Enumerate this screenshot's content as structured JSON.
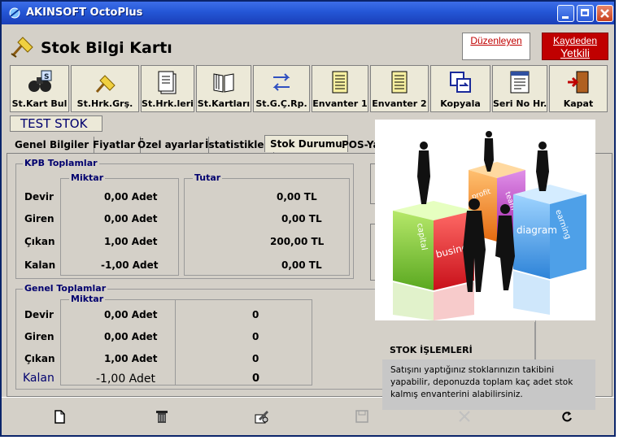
{
  "window": {
    "title": "AKINSOFT OctoPlus"
  },
  "header": {
    "title": "Stok Bilgi Kartı",
    "editor_label": "Düzenleyen",
    "saver_line1": "Kaydeden",
    "saver_line2": "Yetkili"
  },
  "toolbar": {
    "items": [
      {
        "label": "St.Kart Bul",
        "icon": "binoculars-icon"
      },
      {
        "label": "St.Hrk.Grş.",
        "icon": "broom-icon"
      },
      {
        "label": "St.Hrk.leri",
        "icon": "document-icon"
      },
      {
        "label": "St.Kartları",
        "icon": "book-icon"
      },
      {
        "label": "St.G.Ç.Rp.",
        "icon": "swap-arrows-icon"
      },
      {
        "label": "Envanter 1",
        "icon": "ledger-icon"
      },
      {
        "label": "Envanter 2",
        "icon": "ledger-icon"
      },
      {
        "label": "Kopyala",
        "icon": "copy-icon"
      },
      {
        "label": "Seri No Hr.",
        "icon": "form-icon"
      },
      {
        "label": "Kapat",
        "icon": "exit-door-icon"
      }
    ]
  },
  "product": {
    "name": "TEST STOK"
  },
  "tabs": [
    {
      "label": "Genel Bilgiler"
    },
    {
      "label": "Fiyatlar"
    },
    {
      "label": "Özel ayarlar"
    },
    {
      "label": "İstatistikler"
    },
    {
      "label": "Stok Durumu",
      "active": true
    },
    {
      "label": "POS-Ya"
    }
  ],
  "kpb": {
    "title": "KPB Toplamlar",
    "miktar_label": "Miktar",
    "tutar_label": "Tutar",
    "rows": [
      {
        "label": "Devir",
        "miktar": "0,00 Adet",
        "tutar": "0,00 TL"
      },
      {
        "label": "Giren",
        "miktar": "0,00 Adet",
        "tutar": "0,00 TL"
      },
      {
        "label": "Çıkan",
        "miktar": "1,00 Adet",
        "tutar": "200,00 TL"
      },
      {
        "label": "Kalan",
        "miktar": "-1,00 Adet",
        "tutar": "0,00 TL"
      }
    ]
  },
  "genel": {
    "title": "Genel Toplamlar",
    "miktar_label": "Miktar",
    "rows": [
      {
        "label": "Devir",
        "miktar": "0,00 Adet",
        "tutar": "0"
      },
      {
        "label": "Giren",
        "miktar": "0,00 Adet",
        "tutar": "0"
      },
      {
        "label": "Çıkan",
        "miktar": "1,00 Adet",
        "tutar": "0"
      },
      {
        "label": "Kalan",
        "miktar": "-1,00 Adet",
        "tutar": "0"
      }
    ]
  },
  "overlay": {
    "cube_words": [
      "business",
      "capital",
      "profit",
      "team",
      "diagram",
      "earning"
    ],
    "section_title": "STOK İŞLEMLERİ",
    "tip_text": "Satışını yaptığınız stoklarınızın takibini yapabilir,  deponuzda toplam kaç adet stok kalmış envanterini alabilirsiniz."
  },
  "colors": {
    "accent": "#00006e",
    "title_bar": "#2456d6",
    "link_red": "#c00000"
  }
}
